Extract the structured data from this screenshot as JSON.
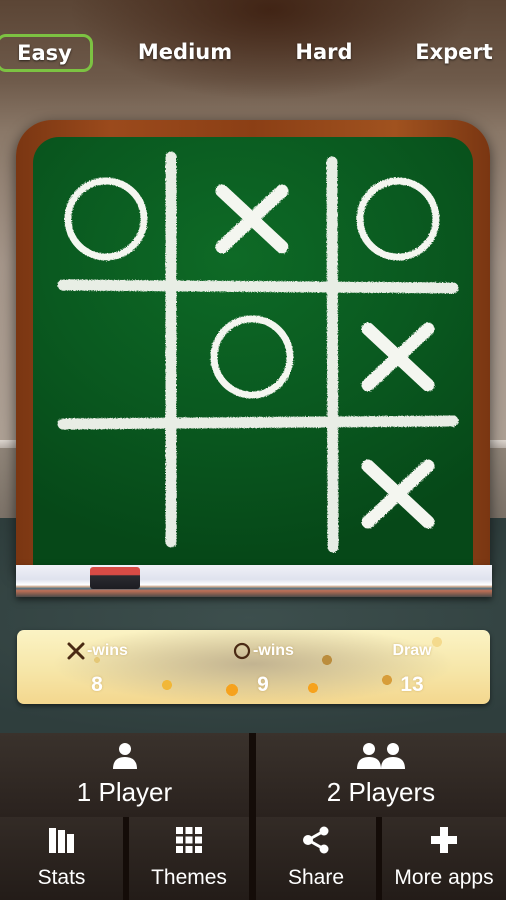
{
  "difficulty": {
    "selected": "Easy",
    "accent_color": "#7cc242",
    "levels": [
      {
        "label": "Easy",
        "selected": true
      },
      {
        "label": "Medium",
        "selected": false
      },
      {
        "label": "Hard",
        "selected": false
      },
      {
        "label": "Expert",
        "selected": false
      }
    ]
  },
  "board": {
    "cells": [
      [
        "O",
        "X",
        "O"
      ],
      [
        "",
        "O",
        "X"
      ],
      [
        "",
        "",
        "X"
      ]
    ]
  },
  "scores": {
    "x_wins": {
      "icon": "x-icon",
      "label": "-wins",
      "value": "8"
    },
    "o_wins": {
      "icon": "o-icon",
      "label": "-wins",
      "value": "9"
    },
    "draw": {
      "label": "Draw",
      "value": "13"
    }
  },
  "modes": [
    {
      "icon": "person-icon",
      "label": "1 Player"
    },
    {
      "icon": "two-persons-icon",
      "label": "2 Players"
    }
  ],
  "nav": [
    {
      "icon": "bar-chart-icon",
      "label": "Stats"
    },
    {
      "icon": "grid-icon",
      "label": "Themes"
    },
    {
      "icon": "share-icon",
      "label": "Share"
    },
    {
      "icon": "plus-icon",
      "label": "More apps"
    }
  ]
}
